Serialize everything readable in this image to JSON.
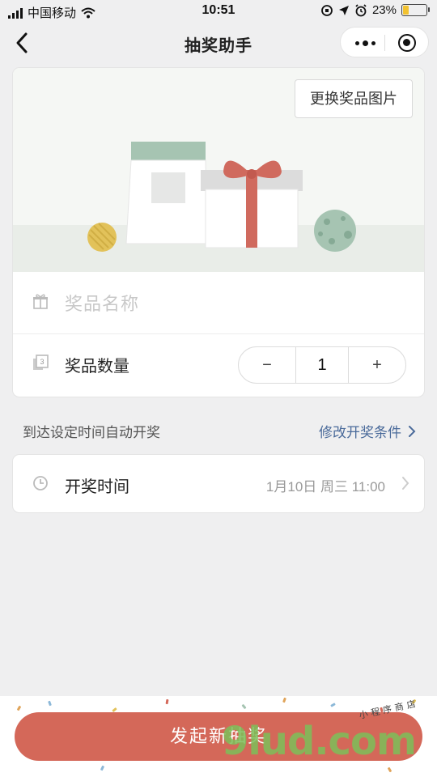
{
  "status_bar": {
    "carrier": "中国移动",
    "time": "10:51",
    "battery": "23%",
    "battery_level": 0.23
  },
  "nav": {
    "title": "抽奖助手"
  },
  "prize_card": {
    "change_image_label": "更换奖品图片",
    "name_placeholder": "奖品名称",
    "quantity_label": "奖品数量",
    "quantity_minus": "−",
    "quantity_value": "1",
    "quantity_plus": "+"
  },
  "condition": {
    "text": "到达设定时间自动开奖",
    "modify_label": "修改开奖条件"
  },
  "time_card": {
    "label": "开奖时间",
    "value": "1月10日 周三 11:00"
  },
  "footer": {
    "launch_label": "发起新抽奖",
    "watermark": "9lud.com",
    "watermark_small": "小程序商店"
  },
  "colors": {
    "primary": "#d46859",
    "link": "#4a6a9a",
    "bag_green": "#a6c4b2",
    "ribbon": "#d06a5e",
    "ball_yellow": "#e2c25a",
    "ball_green": "#a6c4b2"
  }
}
